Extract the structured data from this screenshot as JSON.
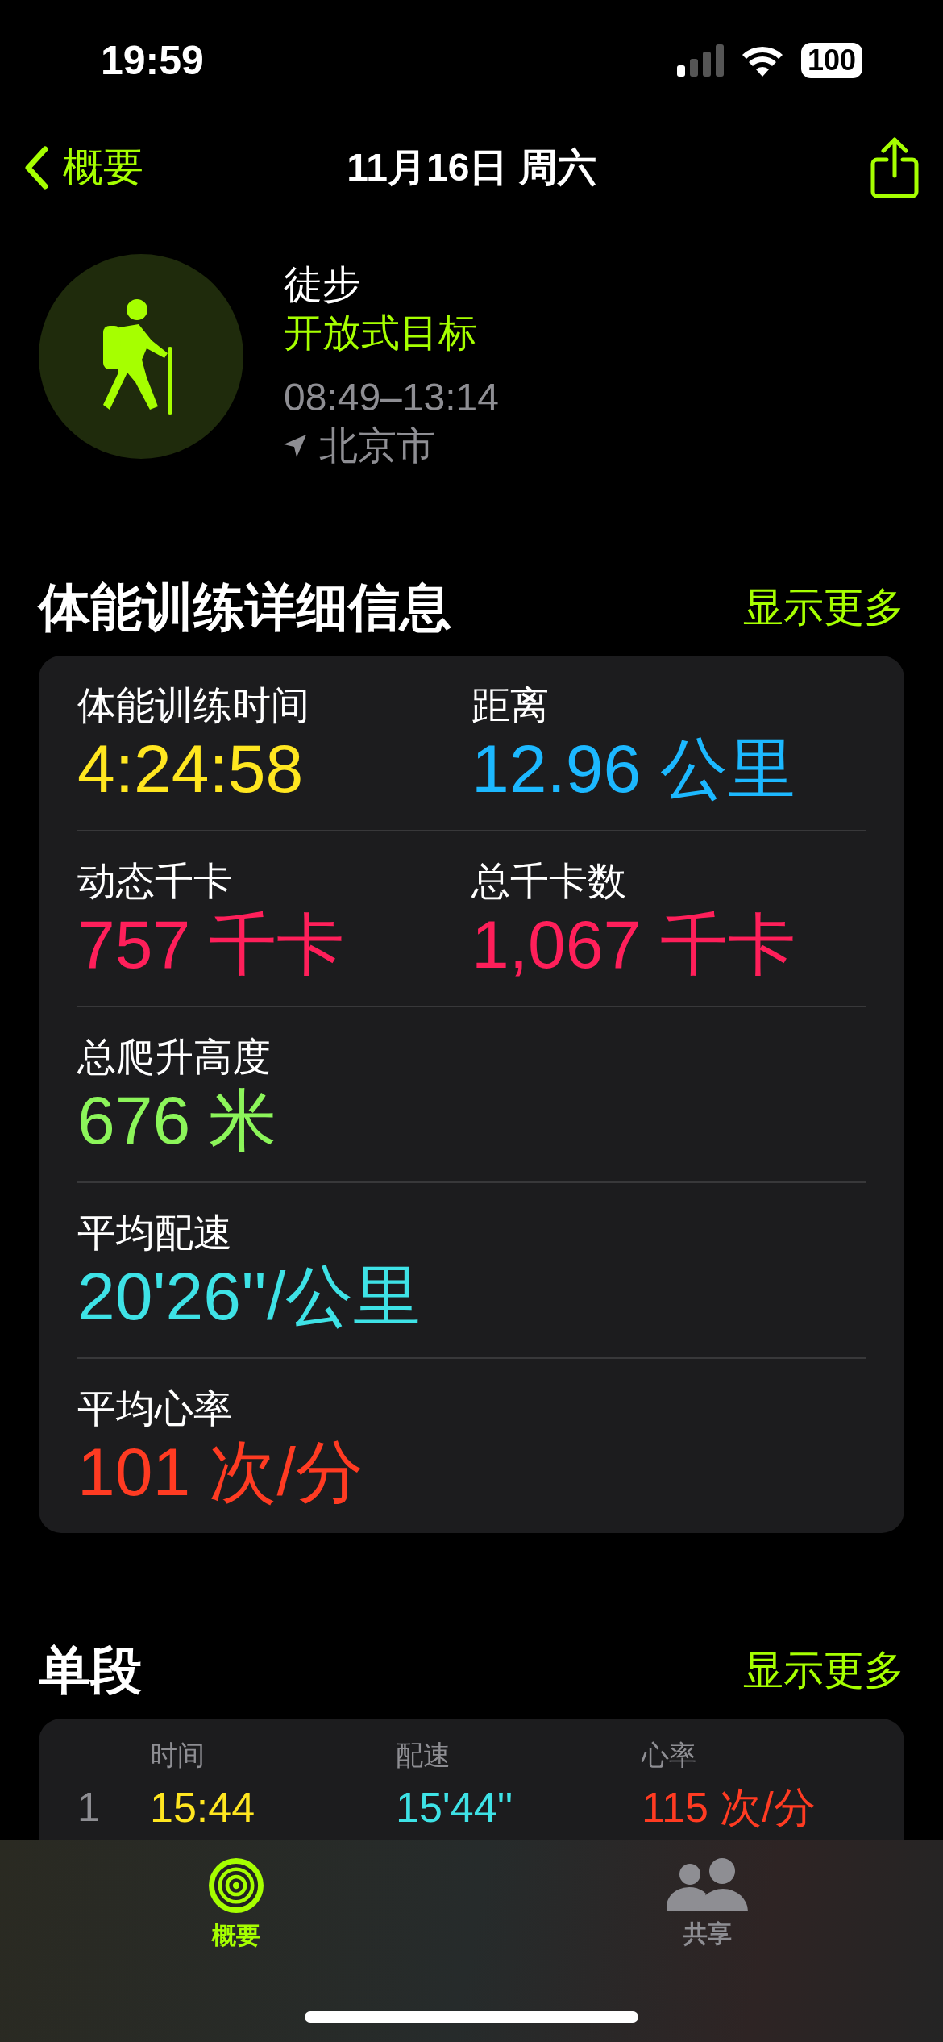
{
  "status_bar": {
    "time": "19:59",
    "battery": "100"
  },
  "nav": {
    "back": "概要",
    "title": "11月16日 周六"
  },
  "workout": {
    "name": "徒步",
    "goal": "开放式目标",
    "time_range": "08:49–13:14",
    "location": "北京市"
  },
  "details": {
    "title": "体能训练详细信息",
    "more": "显示更多",
    "rows": [
      [
        {
          "label": "体能训练时间",
          "value": "4:24:58",
          "color": "#ffe620"
        },
        {
          "label": "距离",
          "value": "12.96 公里",
          "color": "#1cb8ff"
        }
      ],
      [
        {
          "label": "动态千卡",
          "value": "757 千卡",
          "color": "#ff1f5a"
        },
        {
          "label": "总千卡数",
          "value": "1,067 千卡",
          "color": "#ff1f5a"
        }
      ],
      [
        {
          "label": "总爬升高度",
          "value": "676 米",
          "color": "#8cf55a"
        }
      ],
      [
        {
          "label": "平均配速",
          "value": "20'26''/公里",
          "color": "#3ee2e6"
        }
      ],
      [
        {
          "label": "平均心率",
          "value": "101 次/分",
          "color": "#ff3b22"
        }
      ]
    ]
  },
  "splits": {
    "title": "单段",
    "more": "显示更多",
    "columns": [
      "时间",
      "配速",
      "心率"
    ],
    "rows": [
      {
        "index": "1",
        "cells": [
          {
            "text": "15:44",
            "color": "#ffe620"
          },
          {
            "text": "15'44''",
            "color": "#3ee2e6"
          },
          {
            "text": "115 次/分",
            "color": "#ff3b22"
          }
        ]
      }
    ]
  },
  "tabs": [
    {
      "label": "概要",
      "kind": "rings",
      "selected": true
    },
    {
      "label": "共享",
      "kind": "people",
      "selected": false
    }
  ]
}
